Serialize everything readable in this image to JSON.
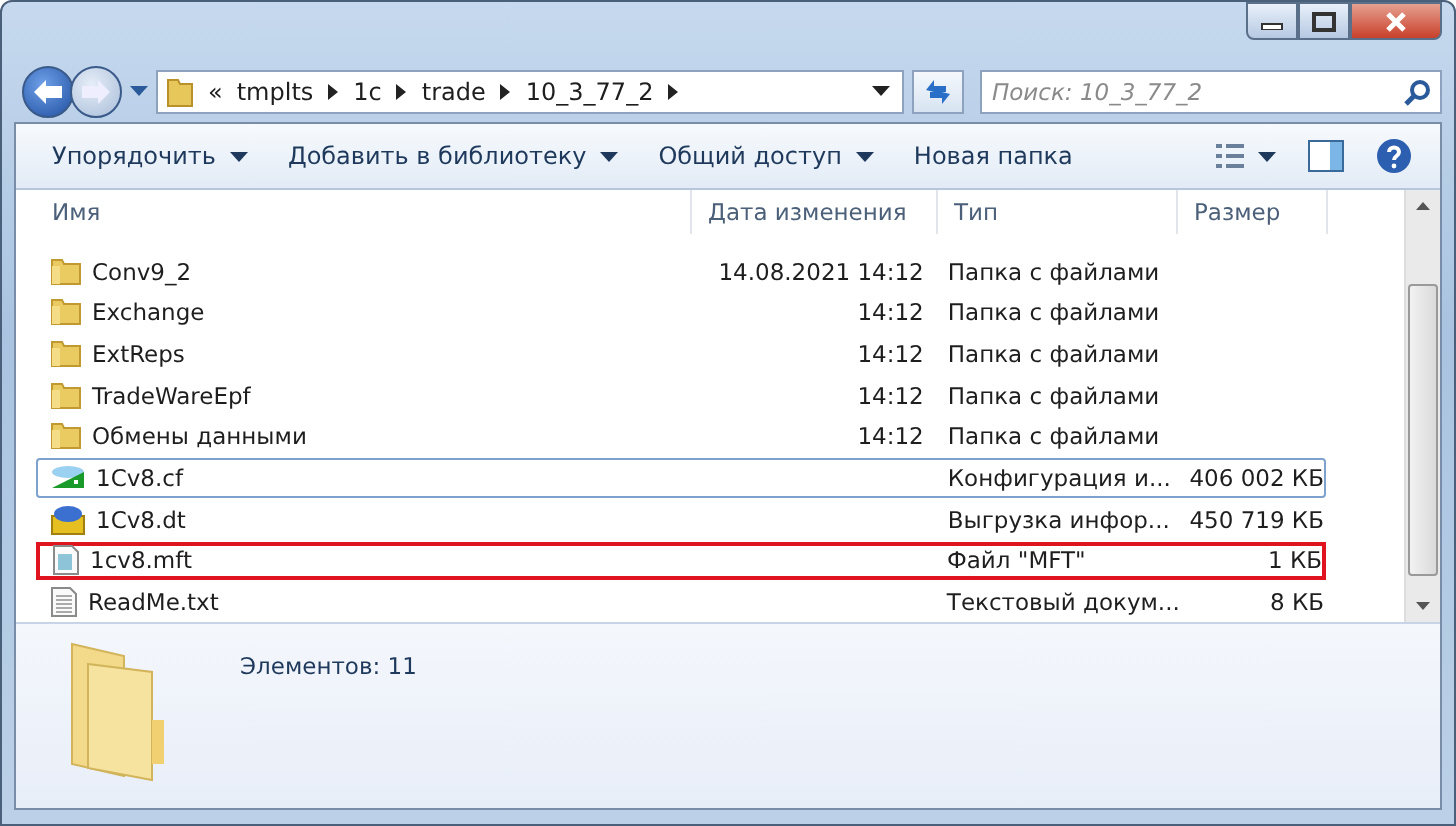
{
  "address": {
    "overflow": "«",
    "crumbs": [
      "tmplts",
      "1c",
      "trade",
      "10_3_77_2"
    ]
  },
  "search": {
    "placeholder": "Поиск: 10_3_77_2"
  },
  "toolbar": [
    {
      "label": "Упорядочить",
      "dropdown": true
    },
    {
      "label": "Добавить в библиотеку",
      "dropdown": true
    },
    {
      "label": "Общий доступ",
      "dropdown": true
    },
    {
      "label": "Новая папка",
      "dropdown": false
    }
  ],
  "columns": [
    "Имя",
    "Дата изменения",
    "Тип",
    "Размер"
  ],
  "rows": [
    {
      "kind": "folder",
      "name": "Conv9_2",
      "date": "14.08.2021 14:12",
      "type": "Папка с файлами",
      "size": "",
      "focused": false,
      "highlighted": false
    },
    {
      "kind": "folder",
      "name": "Exchange",
      "date": "14:12",
      "type": "Папка с файлами",
      "size": "",
      "focused": false,
      "highlighted": false
    },
    {
      "kind": "folder",
      "name": "ExtReps",
      "date": "14:12",
      "type": "Папка с файлами",
      "size": "",
      "focused": false,
      "highlighted": false
    },
    {
      "kind": "folder",
      "name": "TradeWareEpf",
      "date": "14:12",
      "type": "Папка с файлами",
      "size": "",
      "focused": false,
      "highlighted": false
    },
    {
      "kind": "folder",
      "name": "Обмены данными",
      "date": "14:12",
      "type": "Папка с файлами",
      "size": "",
      "focused": false,
      "highlighted": false
    },
    {
      "kind": "config",
      "name": "1Cv8.cf",
      "date": "",
      "type": "Конфигурация и...",
      "size": "406 002 КБ",
      "focused": true,
      "highlighted": false
    },
    {
      "kind": "database",
      "name": "1Cv8.dt",
      "date": "",
      "type": "Выгрузка инфор...",
      "size": "450 719 КБ",
      "focused": false,
      "highlighted": false
    },
    {
      "kind": "file",
      "name": "1cv8.mft",
      "date": "",
      "type": "Файл \"MFT\"",
      "size": "1 КБ",
      "focused": false,
      "highlighted": true
    },
    {
      "kind": "text",
      "name": "ReadMe.txt",
      "date": "",
      "type": "Текстовый докум...",
      "size": "8 КБ",
      "focused": false,
      "highlighted": false
    }
  ],
  "details": {
    "count": "Элементов: 11"
  }
}
